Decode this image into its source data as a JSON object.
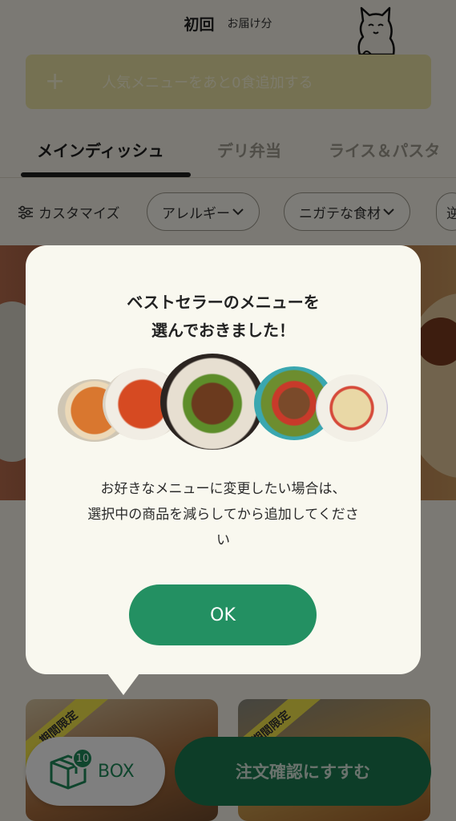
{
  "header": {
    "title": "初回",
    "subtitle": "お届け分"
  },
  "add_bar": {
    "plus": "+",
    "label": "人気メニューをあと0食追加する"
  },
  "tabs": [
    {
      "label": "メインディッシュ",
      "active": true
    },
    {
      "label": "デリ弁当",
      "active": false
    },
    {
      "label": "ライス＆パスタ",
      "active": false
    }
  ],
  "filters": {
    "customize_label": "カスタマイズ",
    "chips": [
      {
        "label": "アレルギー"
      },
      {
        "label": "ニガテな食材"
      },
      {
        "label": "逆"
      }
    ]
  },
  "cards": [
    {
      "ribbon": "期間限定"
    },
    {
      "ribbon": "期間限定"
    }
  ],
  "bottom_bar": {
    "box_count": "10",
    "box_label": "BOX",
    "order_label": "注文確認にすすむ"
  },
  "modal": {
    "title_line1": "ベストセラーのメニューを",
    "title_line2": "選んでおきました！",
    "body_line1": "お好きなメニューに変更したい場合は、",
    "body_line2": "選択中の商品を減らしてから追加してくださ",
    "body_line3": "い",
    "ok_label": "OK"
  },
  "colors": {
    "accent_green": "#239062",
    "order_button": "#1a7a50",
    "add_bar": "#eae3a5",
    "ribbon": "#f5e64a",
    "background": "#f6f3e9",
    "modal_bg": "#f9f8ef"
  }
}
